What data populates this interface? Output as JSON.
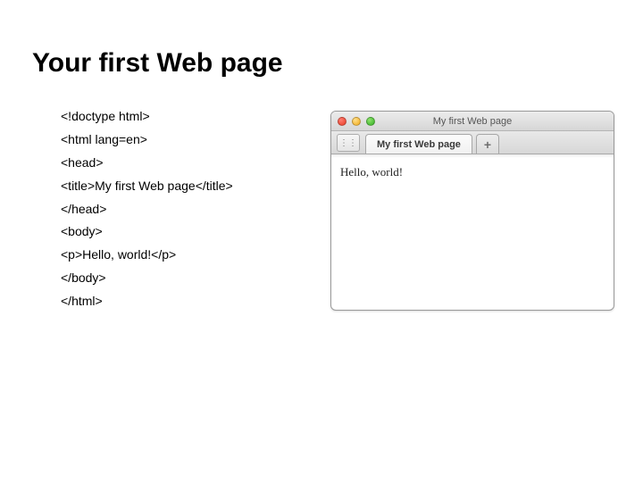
{
  "title": "Your first Web page",
  "code": {
    "l1": "<!doctype html>",
    "l2": "<html lang=en>",
    "l3": "<head>",
    "l4": "<title>My first Web page</title>",
    "l5": "</head>",
    "l6": "<body>",
    "l7": "<p>Hello, world!</p>",
    "l8": "</body>",
    "l9": "</html>"
  },
  "browser": {
    "window_title": "My first Web page",
    "toolbar_button_glyph": "⋮⋮",
    "tab_label": "My first Web page",
    "plus": "+",
    "page_text": "Hello, world!"
  }
}
